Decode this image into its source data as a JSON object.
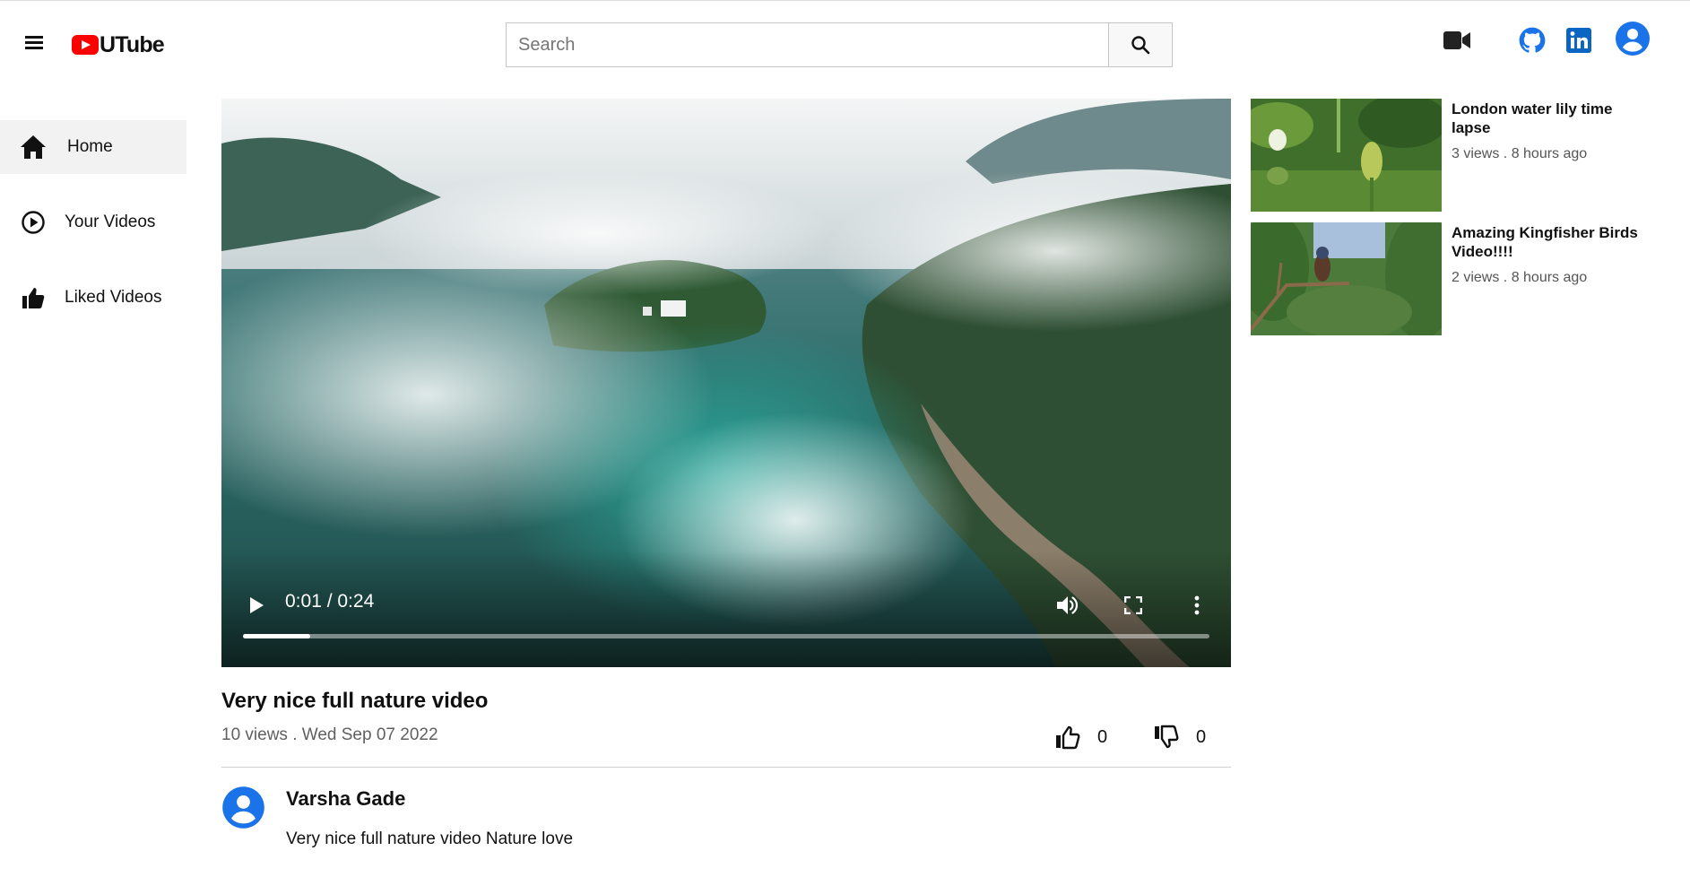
{
  "header": {
    "logo_text": "UTube",
    "search_placeholder": "Search",
    "search_value": ""
  },
  "sidebar": {
    "items": [
      {
        "label": "Home",
        "icon": "home-icon",
        "active": true
      },
      {
        "label": "Your Videos",
        "icon": "play-circle-icon",
        "active": false
      },
      {
        "label": "Liked Videos",
        "icon": "thumb-up-icon",
        "active": false
      }
    ]
  },
  "player": {
    "time": "0:01 / 0:24",
    "progress_fraction": 0.07
  },
  "video": {
    "title": "Very nice full nature video",
    "meta": "10 views . Wed Sep 07 2022",
    "likes": "0",
    "dislikes": "0"
  },
  "comment": {
    "author": "Varsha Gade",
    "text": "Very nice full nature video Nature love"
  },
  "related": [
    {
      "title": "London water lily time lapse",
      "meta": "3 views . 8 hours ago"
    },
    {
      "title": "Amazing Kingfisher Birds Video!!!!",
      "meta": "2 views . 8 hours ago"
    }
  ],
  "colors": {
    "brand_red": "#ff0000",
    "github_blue": "#1a73e8",
    "linkedin_blue": "#0a66c2",
    "avatar_blue": "#1a73e8"
  }
}
